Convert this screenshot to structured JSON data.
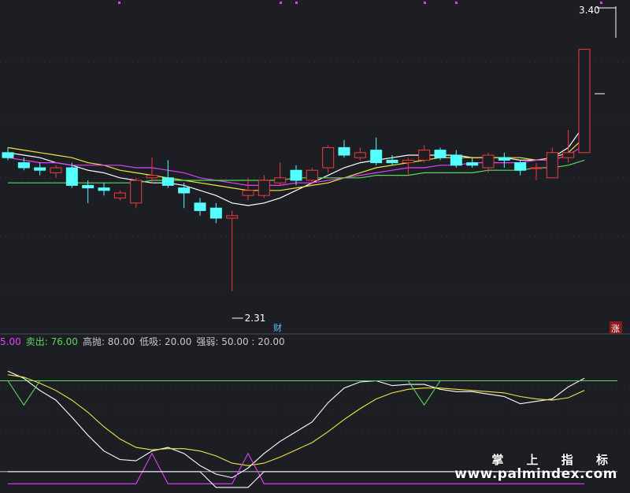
{
  "chart_data": [
    {
      "type": "candlestick",
      "price_labels": {
        "high": "3.40",
        "low": "2.31"
      },
      "ylim": [
        2.2,
        3.45
      ],
      "candles": [
        {
          "o": 2.86,
          "h": 2.88,
          "l": 2.83,
          "c": 2.84
        },
        {
          "o": 2.82,
          "h": 2.84,
          "l": 2.79,
          "c": 2.8
        },
        {
          "o": 2.8,
          "h": 2.82,
          "l": 2.77,
          "c": 2.79
        },
        {
          "o": 2.78,
          "h": 2.81,
          "l": 2.76,
          "c": 2.8
        },
        {
          "o": 2.8,
          "h": 2.82,
          "l": 2.72,
          "c": 2.73
        },
        {
          "o": 2.73,
          "h": 2.75,
          "l": 2.66,
          "c": 2.72
        },
        {
          "o": 2.72,
          "h": 2.74,
          "l": 2.69,
          "c": 2.71
        },
        {
          "o": 2.68,
          "h": 2.71,
          "l": 2.67,
          "c": 2.7
        },
        {
          "o": 2.66,
          "h": 2.76,
          "l": 2.64,
          "c": 2.75
        },
        {
          "o": 2.76,
          "h": 2.84,
          "l": 2.74,
          "c": 2.77
        },
        {
          "o": 2.76,
          "h": 2.83,
          "l": 2.72,
          "c": 2.73
        },
        {
          "o": 2.72,
          "h": 2.74,
          "l": 2.64,
          "c": 2.7
        },
        {
          "o": 2.66,
          "h": 2.68,
          "l": 2.61,
          "c": 2.63
        },
        {
          "o": 2.64,
          "h": 2.66,
          "l": 2.58,
          "c": 2.6
        },
        {
          "o": 2.6,
          "h": 2.63,
          "l": 2.31,
          "c": 2.61
        },
        {
          "o": 2.69,
          "h": 2.76,
          "l": 2.67,
          "c": 2.71
        },
        {
          "o": 2.69,
          "h": 2.77,
          "l": 2.68,
          "c": 2.75
        },
        {
          "o": 2.74,
          "h": 2.82,
          "l": 2.73,
          "c": 2.76
        },
        {
          "o": 2.79,
          "h": 2.81,
          "l": 2.73,
          "c": 2.75
        },
        {
          "o": 2.75,
          "h": 2.8,
          "l": 2.73,
          "c": 2.79
        },
        {
          "o": 2.8,
          "h": 2.89,
          "l": 2.78,
          "c": 2.88
        },
        {
          "o": 2.88,
          "h": 2.91,
          "l": 2.84,
          "c": 2.85
        },
        {
          "o": 2.84,
          "h": 2.88,
          "l": 2.83,
          "c": 2.86
        },
        {
          "o": 2.87,
          "h": 2.92,
          "l": 2.81,
          "c": 2.82
        },
        {
          "o": 2.83,
          "h": 2.85,
          "l": 2.81,
          "c": 2.82
        },
        {
          "o": 2.82,
          "h": 2.84,
          "l": 2.77,
          "c": 2.83
        },
        {
          "o": 2.83,
          "h": 2.89,
          "l": 2.82,
          "c": 2.87
        },
        {
          "o": 2.87,
          "h": 2.88,
          "l": 2.83,
          "c": 2.84
        },
        {
          "o": 2.85,
          "h": 2.87,
          "l": 2.8,
          "c": 2.81
        },
        {
          "o": 2.82,
          "h": 2.84,
          "l": 2.8,
          "c": 2.81
        },
        {
          "o": 2.8,
          "h": 2.86,
          "l": 2.78,
          "c": 2.85
        },
        {
          "o": 2.84,
          "h": 2.86,
          "l": 2.8,
          "c": 2.83
        },
        {
          "o": 2.82,
          "h": 2.83,
          "l": 2.77,
          "c": 2.79
        },
        {
          "o": 2.8,
          "h": 2.82,
          "l": 2.75,
          "c": 2.8
        },
        {
          "o": 2.76,
          "h": 2.88,
          "l": 2.76,
          "c": 2.86
        },
        {
          "o": 2.84,
          "h": 2.95,
          "l": 2.82,
          "c": 2.86
        },
        {
          "o": 2.86,
          "h": 3.27,
          "l": 2.86,
          "c": 3.27
        }
      ],
      "ma_lines": [
        {
          "color": "#ffffff",
          "values": [
            2.86,
            2.85,
            2.84,
            2.82,
            2.81,
            2.79,
            2.78,
            2.76,
            2.75,
            2.74,
            2.74,
            2.73,
            2.71,
            2.69,
            2.66,
            2.65,
            2.66,
            2.68,
            2.71,
            2.74,
            2.77,
            2.8,
            2.82,
            2.83,
            2.84,
            2.85,
            2.85,
            2.85,
            2.85,
            2.84,
            2.84,
            2.84,
            2.83,
            2.83,
            2.84,
            2.88,
            2.97
          ]
        },
        {
          "color": "#f0e442",
          "values": [
            2.88,
            2.87,
            2.86,
            2.85,
            2.84,
            2.82,
            2.81,
            2.79,
            2.78,
            2.77,
            2.76,
            2.75,
            2.74,
            2.73,
            2.72,
            2.71,
            2.71,
            2.71,
            2.72,
            2.73,
            2.74,
            2.76,
            2.78,
            2.8,
            2.81,
            2.82,
            2.83,
            2.84,
            2.84,
            2.84,
            2.84,
            2.84,
            2.84,
            2.83,
            2.84,
            2.86,
            2.92
          ]
        },
        {
          "color": "#e040fb",
          "values": [
            2.84,
            2.83,
            2.82,
            2.82,
            2.81,
            2.81,
            2.81,
            2.81,
            2.8,
            2.8,
            2.79,
            2.78,
            2.76,
            2.75,
            2.74,
            2.73,
            2.73,
            2.73,
            2.74,
            2.74,
            2.75,
            2.76,
            2.77,
            2.78,
            2.79,
            2.8,
            2.8,
            2.81,
            2.81,
            2.82,
            2.82,
            2.82,
            2.82,
            2.83,
            2.83,
            2.85,
            2.89
          ]
        },
        {
          "color": "#5ad85a",
          "values": [
            2.74,
            2.74,
            2.74,
            2.74,
            2.74,
            2.74,
            2.74,
            2.74,
            2.74,
            2.75,
            2.75,
            2.75,
            2.75,
            2.75,
            2.75,
            2.75,
            2.75,
            2.75,
            2.76,
            2.76,
            2.76,
            2.76,
            2.76,
            2.77,
            2.77,
            2.77,
            2.78,
            2.78,
            2.78,
            2.78,
            2.79,
            2.79,
            2.79,
            2.8,
            2.8,
            2.81,
            2.83
          ]
        }
      ],
      "badges": [
        "财",
        "涨"
      ]
    },
    {
      "type": "line",
      "indicator_labels": [
        {
          "text": "5.00",
          "color": "#e040fb"
        },
        {
          "text": "卖出: 76.00",
          "color": "#5ad85a"
        },
        {
          "text": "高抛: 80.00",
          "color": "#c8c8c8"
        },
        {
          "text": "低吸: 20.00",
          "color": "#c8c8c8"
        },
        {
          "text": "强弱: 50.00 : 20.00",
          "color": "#c8c8c8"
        }
      ],
      "ylim": [
        -10,
        105
      ],
      "reference_lines": [
        {
          "value": 80,
          "color": "#5ad85a"
        },
        {
          "value": 5,
          "color": "#c8c8c8"
        }
      ],
      "series": [
        {
          "color": "#ffffff",
          "values": [
            88,
            82,
            72,
            64,
            50,
            35,
            22,
            15,
            14,
            22,
            25,
            20,
            10,
            3,
            0,
            8,
            20,
            30,
            38,
            46,
            62,
            74,
            79,
            80,
            76,
            77,
            77,
            73,
            71,
            71,
            69,
            67,
            61,
            63,
            65,
            75,
            82
          ]
        },
        {
          "color": "#f0e442",
          "values": [
            85,
            83,
            78,
            72,
            64,
            54,
            42,
            32,
            25,
            23,
            24,
            24,
            22,
            18,
            12,
            10,
            12,
            17,
            23,
            29,
            38,
            48,
            57,
            65,
            70,
            73,
            74,
            74,
            73,
            72,
            71,
            70,
            67,
            65,
            64,
            66,
            72
          ]
        },
        {
          "color": "#5ad85a",
          "values": [
            80,
            60,
            80,
            80,
            80,
            80,
            80,
            80,
            80,
            80,
            80,
            80,
            80,
            80,
            80,
            80,
            80,
            80,
            80,
            80,
            80,
            80,
            80,
            80,
            80,
            80,
            60,
            80,
            80,
            80,
            80,
            80,
            80,
            80,
            80,
            80,
            80
          ]
        },
        {
          "color": "#e040fb",
          "values": [
            -5,
            -5,
            -5,
            -5,
            -5,
            -5,
            -5,
            -5,
            -5,
            20,
            -5,
            -5,
            -5,
            -5,
            -5,
            20,
            -5,
            -5,
            -5,
            -5,
            -5,
            -5,
            -5,
            -5,
            -5,
            -5,
            -5,
            -5,
            -5,
            -5,
            -5,
            -5,
            -5,
            -5,
            -5,
            -5,
            -5
          ]
        },
        {
          "color": "#ffffff",
          "values": [
            5,
            5,
            5,
            5,
            5,
            5,
            5,
            5,
            5,
            5,
            5,
            5,
            5,
            -8,
            -8,
            -8,
            5,
            5,
            5,
            5,
            5,
            5,
            5,
            5,
            5,
            5,
            5,
            5,
            5,
            5,
            5,
            5,
            5,
            5,
            5,
            5,
            5
          ]
        }
      ]
    }
  ],
  "watermark": {
    "line1": "掌 上 指 标",
    "line2": "www.palmindex.com"
  }
}
